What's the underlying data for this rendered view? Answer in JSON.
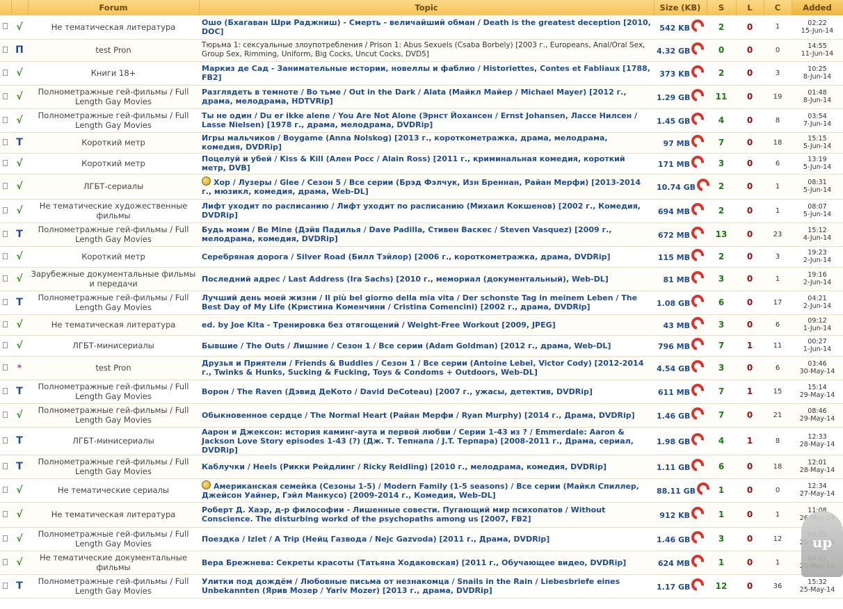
{
  "header": {
    "forum": "Forum",
    "topic": "Topic",
    "size": "Size (KB)",
    "s": "S",
    "l": "L",
    "c": "C",
    "added": "Added"
  },
  "overlay": {
    "label": "up"
  },
  "rows": [
    {
      "status": "√",
      "forum": "Не тематическая литература",
      "topic": "Ошо (Бхагаван Шри Раджниш) - Смерть - величайший обман / Death is the greatest deception [2010, DOC]",
      "size": "542 KB",
      "s": "2",
      "l": "0",
      "c": "1",
      "time": "02:22",
      "date": "15-Jun-14"
    },
    {
      "status": "П",
      "forum": "test Pron",
      "topic": "Тюрьма 1: сексуальные злоупотребления / Prison 1: Abus Sexuels (Csaba Borbely) [2003 г., Europeans, Anal/Oral Sex, Group Sex, Rimming, Uniform, Big Cocks, Uncut Cocks, DVD5]",
      "size": "4.32 GB",
      "s": "0",
      "l": "0",
      "c": "0",
      "time": "14:55",
      "date": "11-Jun-14"
    },
    {
      "status": "√",
      "forum": "Книги 18+",
      "topic": "Маркиз де Сад - Занимательные истории, новеллы и фаблио / Historiettes, Contes et Fabliaux [1788, FB2]",
      "size": "373 KB",
      "s": "2",
      "l": "0",
      "c": "3",
      "time": "10:25",
      "date": "8-Jun-14"
    },
    {
      "status": "√",
      "forum": "Полнометражные гей-фильмы / Full Length Gay Movies",
      "topic": "Разглядеть в темноте / Во тьме / Out in the Dark / Alata (Майкл Майер / Michael Mayer) [2012 г., драма, мелодрама, HDTVRip]",
      "size": "1.29 GB",
      "s": "11",
      "l": "0",
      "c": "19",
      "time": "01:48",
      "date": "8-Jun-14"
    },
    {
      "status": "√",
      "forum": "Полнометражные гей-фильмы / Full Length Gay Movies",
      "topic": "Ты не один / Du er ikke alene / You Are Not Alone (Эрнст Йохансен / Ernst Johansen, Лассе Нилсен / Lasse Nielsen) [1978 г., драма, мелодрама, DVDRip]",
      "size": "1.45 GB",
      "s": "4",
      "l": "0",
      "c": "8",
      "time": "03:54",
      "date": "7-Jun-14"
    },
    {
      "status": "T",
      "forum": "Короткий метр",
      "topic": "Игры мальчиков / Boygame (Anna Nolskog) [2013 г., короткометражка, драма, мелодрама, комедия, DVDRip]",
      "size": "97 MB",
      "s": "7",
      "l": "0",
      "c": "18",
      "time": "15:15",
      "date": "5-Jun-14"
    },
    {
      "status": "√",
      "forum": "Короткий метр",
      "topic": "Поцелуй и убей / Kiss & Kill (Ален Росс / Alain Ross) [2011 г., криминальная комедия, короткий метр, DVB]",
      "size": "171 MB",
      "s": "3",
      "l": "0",
      "c": "6",
      "time": "13:19",
      "date": "5-Jun-14"
    },
    {
      "status": "√",
      "forum": "ЛГБТ-сериалы",
      "topic": "Хор / Лузеры / Glee / Сезон 5 / Все серии (Брэд Фэлчук, Изн Бреннан, Райан Мерфи) [2013-2014 г., мюзикл, комедия, драма, Web-DL]",
      "medal": true,
      "size": "10.74 GB",
      "s": "2",
      "l": "0",
      "c": "1",
      "time": "08:31",
      "date": "5-Jun-14"
    },
    {
      "status": "√",
      "forum": "Не тематические художественные фильмы",
      "topic": "Лифт уходит по расписанию / Лифт уходит по расписанию (Михаил Кокшенов) [2002 г., Комедия, DVDRip]",
      "size": "694 MB",
      "s": "2",
      "l": "0",
      "c": "1",
      "time": "08:07",
      "date": "5-Jun-14"
    },
    {
      "status": "T",
      "forum": "Полнометражные гей-фильмы / Full Length Gay Movies",
      "topic": "Будь моим / Be Mine (Дэйв Падилья / Dave Padilla, Стивен Васкес / Steven Vasquez) [2009 г., мелодрама, комедия, DVDRip]",
      "size": "672 MB",
      "s": "13",
      "l": "0",
      "c": "23",
      "time": "15:12",
      "date": "4-Jun-14"
    },
    {
      "status": "√",
      "forum": "Короткий метр",
      "topic": "Серебряная дорога / Silver Road (Билл Тэйлор) [2006 г., короткометражка, драма, DVDRip]",
      "size": "115 MB",
      "s": "2",
      "l": "0",
      "c": "3",
      "time": "19:23",
      "date": "2-Jun-14"
    },
    {
      "status": "√",
      "forum": "Зарубежные документальные фильмы и передачи",
      "topic": "Последний адрес / Last Address (Ira Sachs) [2010 г., мемориал (документальный), Web-DL]",
      "size": "81 MB",
      "s": "3",
      "l": "0",
      "c": "1",
      "time": "19:16",
      "date": "2-Jun-14"
    },
    {
      "status": "T",
      "forum": "Полнометражные гей-фильмы / Full Length Gay Movies",
      "topic": "Лучший день моей жизни / Il più bel giorno della mia vita / Der schonste Tag in meinem Leben / The Best Day of My Life (Кристина Коменчини / Cristina Comencini) [2002 г., драма, DVDRip]",
      "size": "1.08 GB",
      "s": "6",
      "l": "0",
      "c": "17",
      "time": "04:21",
      "date": "2-Jun-14"
    },
    {
      "status": "√",
      "forum": "Не тематическая литература",
      "topic": "ed. by Joe Kita - Тренировка без отягощений / Weight-Free Workout [2009, JPEG]",
      "size": "43 MB",
      "s": "3",
      "l": "0",
      "c": "6",
      "time": "09:12",
      "date": "1-Jun-14"
    },
    {
      "status": "√",
      "forum": "ЛГБТ-минисериалы",
      "topic": "Бывшие / The Outs / Лишние / Сезон 1 / Все серии (Adam Goldman) [2012 г., драма, Web-DL]",
      "size": "796 MB",
      "s": "7",
      "l": "1",
      "c": "11",
      "time": "00:27",
      "date": "1-Jun-14"
    },
    {
      "status": "*",
      "forum": "test Pron",
      "topic": "Друзья и Приятели / Friends & Buddies / Сезон 1 / Все серии (Antoine Lebel, Victor Cody) [2012-2014 г., Twinks & Hunks, Sucking & Fucking, Toys & Condoms + Outdoors, Web-DL]",
      "size": "4.54 GB",
      "s": "3",
      "l": "0",
      "c": "6",
      "time": "03:46",
      "date": "30-May-14"
    },
    {
      "status": "T",
      "forum": "Полнометражные гей-фильмы / Full Length Gay Movies",
      "topic": "Ворон / The Raven (Дэвид ДеКото / David DeCoteau) [2007 г., ужасы, детектив, DVDRip]",
      "size": "611 MB",
      "s": "7",
      "l": "1",
      "c": "15",
      "time": "15:14",
      "date": "29-May-14"
    },
    {
      "status": "√",
      "forum": "Полнометражные гей-фильмы / Full Length Gay Movies",
      "topic": "Обыкновенное сердце / The Normal Heart (Райан Мерфи / Ryan Murphy) [2014 г., Драма, DVDRip]",
      "size": "1.46 GB",
      "s": "7",
      "l": "0",
      "c": "21",
      "time": "08:46",
      "date": "29-May-14"
    },
    {
      "status": "T",
      "forum": "ЛГБТ-минисериалы",
      "topic": "Аарон и Джексон: история каминг-аута и первой любви / Серии 1-43 из ? / Emmerdale: Aaron & Jackson Love Story episodes 1-43 (?) (Дж. Т. Тепнапа / J.T. Терпара) [2008-2011 г., Драма, сериал, DVDRip]",
      "size": "1.98 GB",
      "s": "4",
      "l": "1",
      "c": "8",
      "time": "12:33",
      "date": "28-May-14"
    },
    {
      "status": "T",
      "forum": "Полнометражные гей-фильмы / Full Length Gay Movies",
      "topic": "Каблучки / Heels (Рикки Рейдлинг / Ricky Reidling) [2010 г., мелодрама, комедия, DVDRip]",
      "size": "1.11 GB",
      "s": "6",
      "l": "0",
      "c": "18",
      "time": "12:01",
      "date": "28-May-14"
    },
    {
      "status": "√",
      "forum": "Не тематические сериалы",
      "topic": "Американская семейка (Сезоны 1-5) / Modern Family (1-5 seasons) / Все серии (Майкл Спиллер, Джейсон Уайнер, Гэйл Манкусо) [2009-2014 г., Комедия, Web-DL]",
      "medal": true,
      "size": "88.11 GB",
      "s": "1",
      "l": "0",
      "c": "0",
      "time": "12:34",
      "date": "27-May-14"
    },
    {
      "status": "√",
      "forum": "Не тематическая литература",
      "topic": "Роберт Д. Хаэр, д-р философии - Лишенные совести. Пугающий мир психопатов / Without Conscience. The disturbing workd of the psychopaths among us [2007, FB2]",
      "size": "912 KB",
      "s": "1",
      "l": "0",
      "c": "1",
      "time": "11:08",
      "date": "26-May-14"
    },
    {
      "status": "√",
      "forum": "Полнометражные гей-фильмы / Full Length Gay Movies",
      "topic": "Поездка / Izlet / A Trip (Нейц Газвода / Nejc Gazvoda) [2011 г., Драма, DVDRip]",
      "size": "1.46 GB",
      "s": "3",
      "l": "0",
      "c": "12",
      "time": "09:25",
      "date": "26-May-14"
    },
    {
      "status": "√",
      "forum": "Не тематические документальные фильмы",
      "topic": "Вера Брежнева: Секреты красоты (Татьяна Ходаковская) [2011 г., Обучающее видео, DVDRip]",
      "size": "624 MB",
      "s": "1",
      "l": "0",
      "c": "1",
      "time": "04:02",
      "date": "26-May-14"
    },
    {
      "status": "T",
      "forum": "Полнометражные гей-фильмы / Full Length Gay Movies",
      "topic": "Улитки под дождём / Любовные письма от незнакомца / Snails in the Rain / Liebesbriefe eines Unbekannten (Ярив Мозер / Yariv Mozer) [2013 г., драма, DVDRip]",
      "size": "1.17 GB",
      "s": "12",
      "l": "0",
      "c": "36",
      "time": "15:32",
      "date": "25-May-14"
    }
  ]
}
